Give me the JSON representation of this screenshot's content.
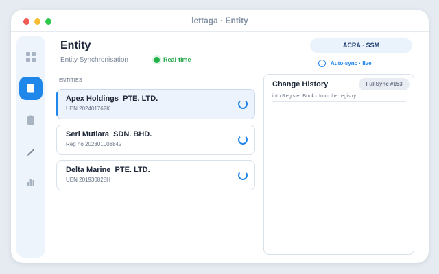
{
  "window": {
    "title": "lettaga · Entity"
  },
  "header": {
    "title": "Entity",
    "subtitle": "Entity Synchronisation",
    "status_label": "Real-time",
    "source_button": "ACRA · SSM",
    "auto_sync_label": "Auto-sync · live"
  },
  "sidebar": {
    "items": [
      {
        "icon": "grid-icon",
        "active": false
      },
      {
        "icon": "document-icon",
        "active": true
      },
      {
        "icon": "clipboard-icon",
        "active": false
      },
      {
        "icon": "pen-icon",
        "active": false
      },
      {
        "icon": "bar-chart-icon",
        "active": false
      }
    ]
  },
  "entities": {
    "section_label": "ENTITIES",
    "items": [
      {
        "name": "Apex Holdings  PTE. LTD.",
        "id": "UEN 202401762K"
      },
      {
        "name": "Seri Mutiara  SDN. BHD.",
        "id": "Reg no 202301008842"
      },
      {
        "name": "Delta Marine  PTE. LTD.",
        "id": "UEN 201930828H"
      }
    ]
  },
  "history": {
    "title": "Change History",
    "badge": "FullSync #153",
    "note": "into Register Book · from the registry"
  },
  "colors": {
    "accent": "#1f86ea",
    "live": "#22b24a",
    "title": "#1e2738"
  }
}
